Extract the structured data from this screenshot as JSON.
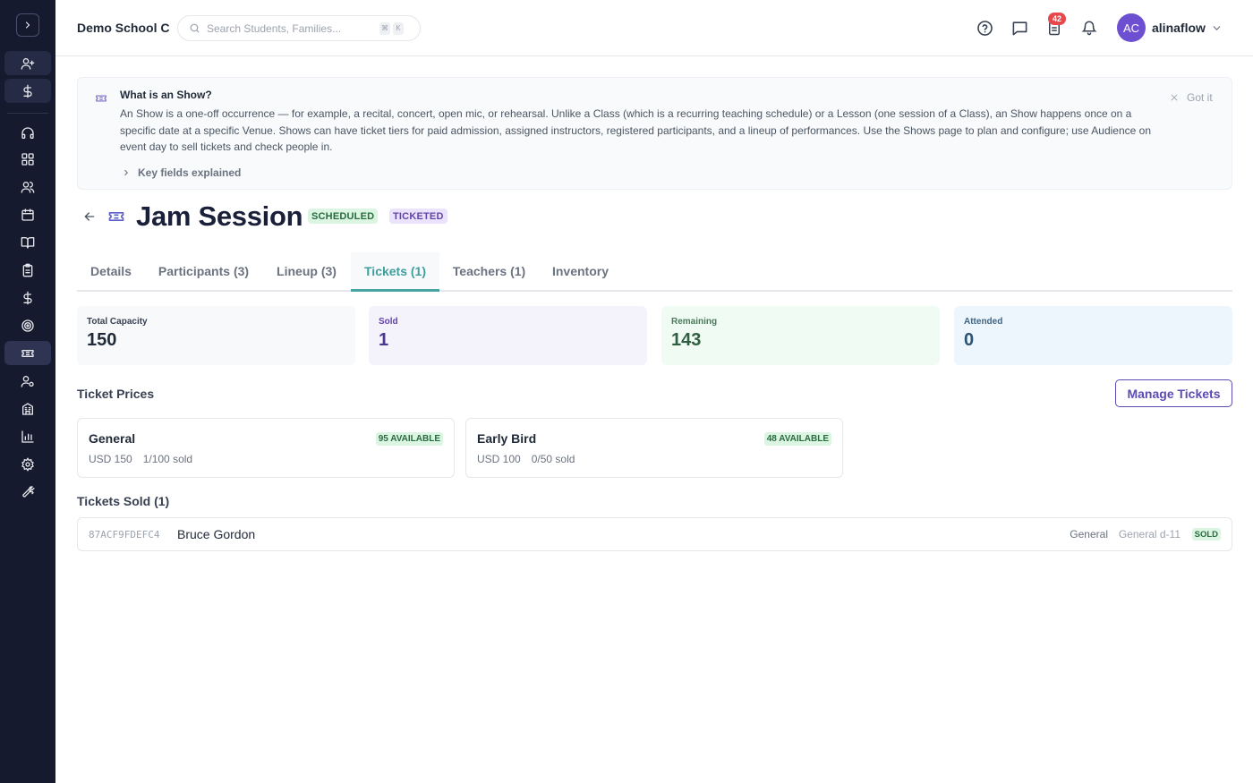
{
  "header": {
    "school_name": "Demo School C",
    "search_placeholder": "Search Students, Families...",
    "search_shortcut": [
      "⌘",
      "K"
    ],
    "notification_count": "42",
    "avatar_initials": "AC",
    "username": "alinaflow"
  },
  "sidebar": {
    "items": [
      {
        "icon": "user-plus-icon"
      },
      {
        "icon": "dollar-icon"
      },
      {
        "icon": "headset-icon"
      },
      {
        "icon": "dashboard-grid-icon"
      },
      {
        "icon": "users-icon"
      },
      {
        "icon": "calendar-icon"
      },
      {
        "icon": "book-open-icon"
      },
      {
        "icon": "clipboard-icon"
      },
      {
        "icon": "dollar-icon"
      },
      {
        "icon": "target-icon"
      },
      {
        "icon": "ticket-icon",
        "active": true
      },
      {
        "icon": "user-cog-icon"
      },
      {
        "icon": "building-icon"
      },
      {
        "icon": "bar-chart-icon"
      },
      {
        "icon": "gear-icon"
      },
      {
        "icon": "wrench-icon"
      }
    ]
  },
  "info_banner": {
    "title": "What is an Show?",
    "body": "An Show is a one-off occurrence — for example, a recital, concert, open mic, or rehearsal. Unlike a Class (which is a recurring teaching schedule) or a Lesson (one session of a Class), an Show happens once on a specific date at a specific Venue. Shows can have ticket tiers for paid admission, assigned instructors, registered participants, and a lineup of performances. Use the Shows page to plan and configure; use Audience on event day to sell tickets and check people in.",
    "dismiss_label": "Got it",
    "expander_label": "Key fields explained"
  },
  "show": {
    "title": "Jam Session",
    "status_badge": "SCHEDULED",
    "type_badge": "TICKETED"
  },
  "tabs": [
    {
      "label": "Details",
      "active": false
    },
    {
      "label": "Participants (3)",
      "active": false
    },
    {
      "label": "Lineup (3)",
      "active": false
    },
    {
      "label": "Tickets (1)",
      "active": true
    },
    {
      "label": "Teachers (1)",
      "active": false
    },
    {
      "label": "Inventory",
      "active": false
    }
  ],
  "stats": [
    {
      "label": "Total Capacity",
      "value": "150"
    },
    {
      "label": "Sold",
      "value": "1"
    },
    {
      "label": "Remaining",
      "value": "143"
    },
    {
      "label": "Attended",
      "value": "0"
    }
  ],
  "ticket_prices": {
    "section_label": "Ticket Prices",
    "manage_button": "Manage Tickets",
    "tiers": [
      {
        "name": "General",
        "price": "USD 150",
        "sold": "1/100 sold",
        "available": "95 AVAILABLE"
      },
      {
        "name": "Early Bird",
        "price": "USD 100",
        "sold": "0/50 sold",
        "available": "48 AVAILABLE"
      }
    ]
  },
  "tickets_sold": {
    "section_label": "Tickets Sold (1)",
    "rows": [
      {
        "id": "87ACF9FDEFC4",
        "name": "Bruce Gordon",
        "tier": "General",
        "seat": "General d-11",
        "status": "SOLD"
      }
    ]
  },
  "colors": {
    "sidebar_bg": "#161a2e",
    "accent_teal": "#4aa3a3",
    "accent_purple": "#5b4bb5",
    "avatar": "#6d4fd1",
    "badge_red": "#e5484d"
  }
}
